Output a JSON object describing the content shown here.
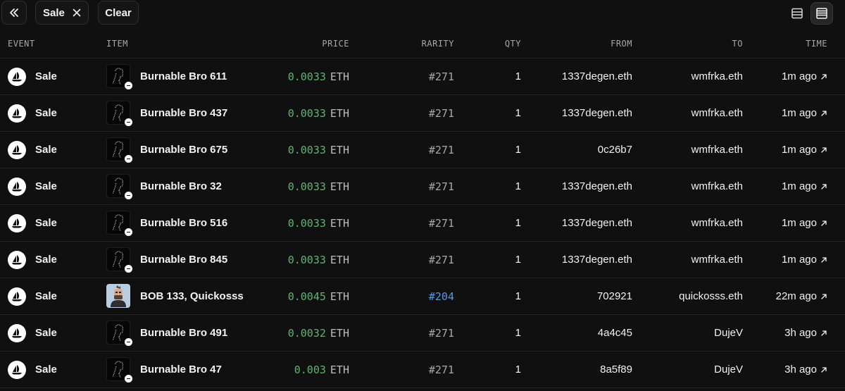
{
  "toolbar": {
    "collapse_icon": "double-chevron-left-icon",
    "filter_chip": {
      "label": "Sale",
      "remove_icon": "close-icon"
    },
    "clear_label": "Clear",
    "view_list_icon": "list-view-icon",
    "view_detail_icon": "detail-view-icon"
  },
  "columns": {
    "event": "EVENT",
    "item": "ITEM",
    "price": "PRICE",
    "rarity": "RARITY",
    "qty": "QTY",
    "from": "FROM",
    "to": "TO",
    "time": "TIME"
  },
  "colors": {
    "price_amount": "#5fb472",
    "rarity_highlight": "#5a98e6",
    "background": "#101010"
  },
  "rows": [
    {
      "event": "Sale",
      "event_icon": "opensea-icon",
      "item": "Burnable Bro 611",
      "thumb": "burnable-bro-thumbnail",
      "price": "0.0033",
      "currency": "ETH",
      "rarity": "#271",
      "qty": "1",
      "from": "1337degen.eth",
      "to": "wmfrka.eth",
      "time": "1m ago"
    },
    {
      "event": "Sale",
      "event_icon": "opensea-icon",
      "item": "Burnable Bro 437",
      "thumb": "burnable-bro-thumbnail",
      "price": "0.0033",
      "currency": "ETH",
      "rarity": "#271",
      "qty": "1",
      "from": "1337degen.eth",
      "to": "wmfrka.eth",
      "time": "1m ago"
    },
    {
      "event": "Sale",
      "event_icon": "opensea-icon",
      "item": "Burnable Bro 675",
      "thumb": "burnable-bro-thumbnail",
      "price": "0.0033",
      "currency": "ETH",
      "rarity": "#271",
      "qty": "1",
      "from": "0c26b7",
      "to": "wmfrka.eth",
      "time": "1m ago"
    },
    {
      "event": "Sale",
      "event_icon": "opensea-icon",
      "item": "Burnable Bro 32",
      "thumb": "burnable-bro-thumbnail",
      "price": "0.0033",
      "currency": "ETH",
      "rarity": "#271",
      "qty": "1",
      "from": "1337degen.eth",
      "to": "wmfrka.eth",
      "time": "1m ago"
    },
    {
      "event": "Sale",
      "event_icon": "opensea-icon",
      "item": "Burnable Bro 516",
      "thumb": "burnable-bro-thumbnail",
      "price": "0.0033",
      "currency": "ETH",
      "rarity": "#271",
      "qty": "1",
      "from": "1337degen.eth",
      "to": "wmfrka.eth",
      "time": "1m ago"
    },
    {
      "event": "Sale",
      "event_icon": "opensea-icon",
      "item": "Burnable Bro 845",
      "thumb": "burnable-bro-thumbnail",
      "price": "0.0033",
      "currency": "ETH",
      "rarity": "#271",
      "qty": "1",
      "from": "1337degen.eth",
      "to": "wmfrka.eth",
      "time": "1m ago"
    },
    {
      "event": "Sale",
      "event_icon": "opensea-icon",
      "item": "BOB 133, Quickosss",
      "thumb": "bob-avatar-thumbnail",
      "price": "0.0045",
      "currency": "ETH",
      "rarity": "#204",
      "qty": "1",
      "from": "702921",
      "to": "quickosss.eth",
      "time": "22m ago"
    },
    {
      "event": "Sale",
      "event_icon": "opensea-icon",
      "item": "Burnable Bro 491",
      "thumb": "burnable-bro-thumbnail",
      "price": "0.0032",
      "currency": "ETH",
      "rarity": "#271",
      "qty": "1",
      "from": "4a4c45",
      "to": "DujeV",
      "time": "3h ago"
    },
    {
      "event": "Sale",
      "event_icon": "opensea-icon",
      "item": "Burnable Bro 47",
      "thumb": "burnable-bro-thumbnail",
      "price": "0.003",
      "currency": "ETH",
      "rarity": "#271",
      "qty": "1",
      "from": "8a5f89",
      "to": "DujeV",
      "time": "3h ago"
    }
  ]
}
